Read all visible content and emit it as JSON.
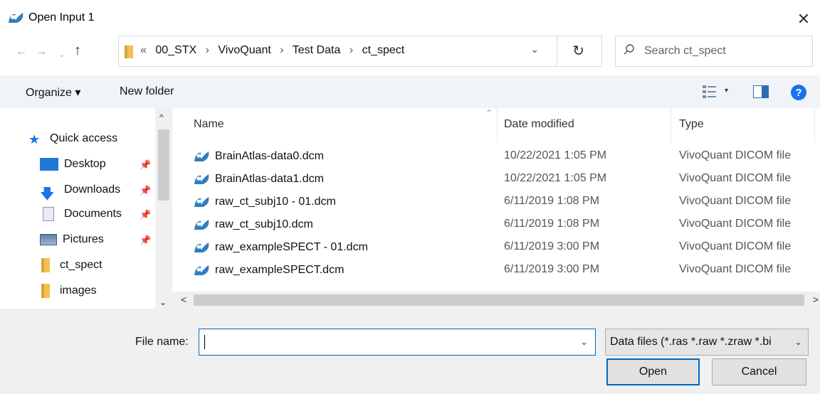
{
  "window": {
    "title": "Open Input 1",
    "close_glyph": "✕"
  },
  "nav": {
    "back_glyph": "←",
    "forward_glyph": "→",
    "recent_glyph": "⌄",
    "up_glyph": "↑"
  },
  "address": {
    "overflow": "«",
    "separator": "›",
    "crumbs": [
      "00_STX",
      "VivoQuant",
      "Test Data",
      "ct_spect"
    ],
    "dropdown_glyph": "⌄",
    "refresh_glyph": "↻"
  },
  "search": {
    "placeholder": "Search ct_spect"
  },
  "toolbar": {
    "organize_label": "Organize ▾",
    "new_folder_label": "New folder",
    "view_caret": "▾",
    "help_label": "?"
  },
  "sidebar": {
    "items": [
      {
        "label": "Quick access",
        "icon": "star-icon"
      },
      {
        "label": "Desktop",
        "icon": "desktop-icon",
        "pinned": true
      },
      {
        "label": "Downloads",
        "icon": "download-icon",
        "pinned": true
      },
      {
        "label": "Documents",
        "icon": "documents-icon",
        "pinned": true
      },
      {
        "label": "Pictures",
        "icon": "pictures-icon",
        "pinned": true
      },
      {
        "label": "ct_spect",
        "icon": "folder-icon"
      },
      {
        "label": "images",
        "icon": "folder-icon"
      }
    ],
    "pin_glyph": "📌"
  },
  "filelist": {
    "columns": {
      "name": "Name",
      "date": "Date modified",
      "type": "Type",
      "sort_glyph": "⌃"
    },
    "rows": [
      {
        "name": "BrainAtlas-data0.dcm",
        "date": "10/22/2021 1:05 PM",
        "type": "VivoQuant DICOM file"
      },
      {
        "name": "BrainAtlas-data1.dcm",
        "date": "10/22/2021 1:05 PM",
        "type": "VivoQuant DICOM file"
      },
      {
        "name": "raw_ct_subj10 - 01.dcm",
        "date": "6/11/2019 1:08 PM",
        "type": "VivoQuant DICOM file"
      },
      {
        "name": "raw_ct_subj10.dcm",
        "date": "6/11/2019 1:08 PM",
        "type": "VivoQuant DICOM file"
      },
      {
        "name": "raw_exampleSPECT - 01.dcm",
        "date": "6/11/2019 3:00 PM",
        "type": "VivoQuant DICOM file"
      },
      {
        "name": "raw_exampleSPECT.dcm",
        "date": "6/11/2019 3:00 PM",
        "type": "VivoQuant DICOM file"
      }
    ]
  },
  "scroll": {
    "up": "^",
    "down": "⌄",
    "left": "<",
    "right": ">"
  },
  "footer": {
    "file_name_label": "File name:",
    "file_name_value": "",
    "dropdown_glyph": "⌄",
    "filter_value": "Data files (*.ras *.raw *.zraw *.bi",
    "open_label": "Open",
    "cancel_label": "Cancel"
  },
  "colors": {
    "accent": "#0067c0",
    "toolbar_bg": "#f0f4f9",
    "footer_bg": "#f0f0f0"
  }
}
